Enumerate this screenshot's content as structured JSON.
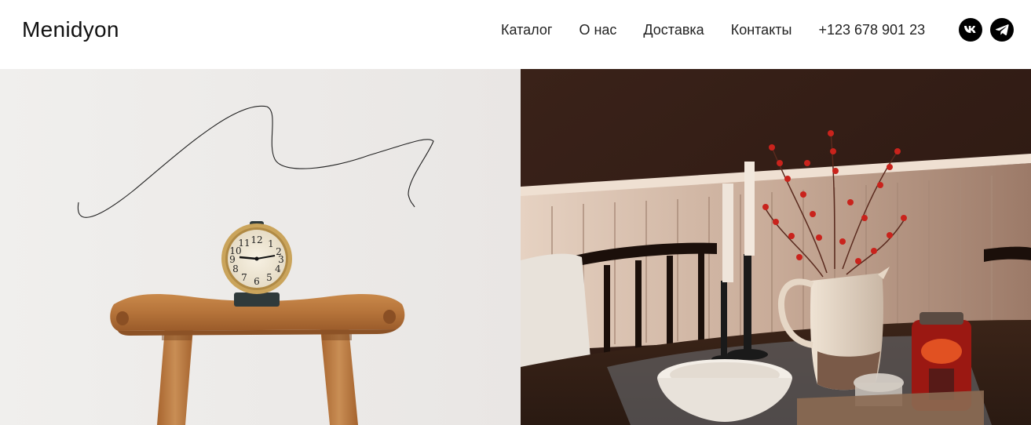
{
  "brand": {
    "logo": "Menidyon"
  },
  "nav": {
    "items": [
      {
        "label": "Каталог"
      },
      {
        "label": "О нас"
      },
      {
        "label": "Доставка"
      },
      {
        "label": "Контакты"
      }
    ],
    "phone": "+123 678 901 23"
  },
  "social": [
    {
      "icon": "vk-icon"
    },
    {
      "icon": "telegram-icon"
    }
  ],
  "colors": {
    "header_bg": "#ffffff",
    "text": "#222222",
    "icon_bg": "#000000"
  }
}
